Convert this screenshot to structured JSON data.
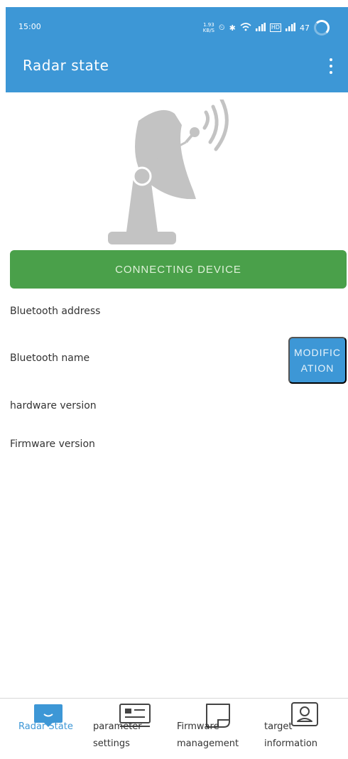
{
  "status_bar": {
    "time": "15:00",
    "net_speed": "1.93\nKB/S",
    "battery": "47"
  },
  "app_bar": {
    "title": "Radar state",
    "menu_icon": "more-vert-icon"
  },
  "hero_icon": "radar-dish-icon",
  "connect_button": "CONNECTING DEVICE",
  "info": {
    "bluetooth_address": "Bluetooth address",
    "bluetooth_name": "Bluetooth name",
    "hardware_version": "hardware version",
    "firmware_version": "Firmware version"
  },
  "modification_button": "MODIFICATION",
  "bottom_nav": {
    "items": [
      {
        "label": "Radar State",
        "icon": "radar-state-icon",
        "active": true
      },
      {
        "label": "parameter\nsettings",
        "icon": "parameter-settings-icon",
        "active": false
      },
      {
        "label": "Firmware\nmanagement",
        "icon": "firmware-icon",
        "active": false
      },
      {
        "label": "target\ninformation",
        "icon": "target-info-icon",
        "active": false
      }
    ]
  },
  "colors": {
    "primary": "#3d97d6",
    "connect": "#4aa04a",
    "illustration": "#c3c3c3"
  }
}
